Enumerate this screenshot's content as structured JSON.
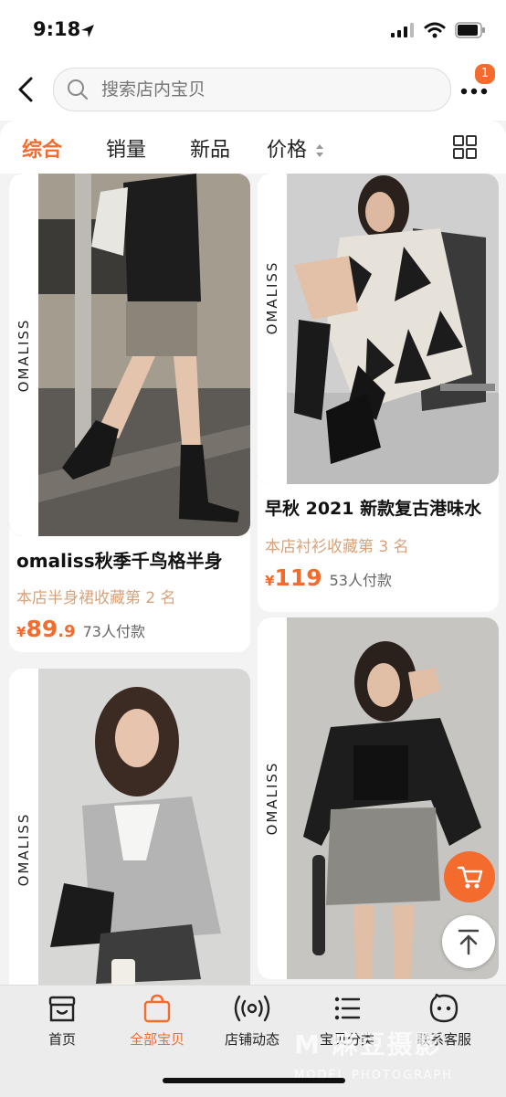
{
  "status": {
    "time": "9:18"
  },
  "search": {
    "placeholder": "搜索店内宝贝",
    "badge_count": "1"
  },
  "sort_tabs": [
    {
      "label": "综合",
      "active": true
    },
    {
      "label": "销量"
    },
    {
      "label": "新品"
    },
    {
      "label": "价格"
    }
  ],
  "products": [
    {
      "brand": "OMALISS",
      "title": "omaliss秋季千鸟格半身",
      "rank": "本店半身裙收藏第 2 名",
      "price_symbol": "¥",
      "price_int": "89",
      "price_dec": ".9",
      "sales": "73人付款"
    },
    {
      "brand": "OMALISS",
      "title": "早秋 2021 新款复古港味水",
      "rank": "本店衬衫收藏第 3 名",
      "price_symbol": "¥",
      "price_int": "119",
      "price_dec": "",
      "sales": "53人付款"
    },
    {
      "brand": "OMALISS"
    },
    {
      "brand": "OMALISS"
    }
  ],
  "bottom_nav": [
    {
      "label": "首页",
      "icon": "storefront-icon"
    },
    {
      "label": "全部宝贝",
      "icon": "shopping-bag-icon",
      "active": true
    },
    {
      "label": "店铺动态",
      "icon": "broadcast-icon"
    },
    {
      "label": "宝贝分类",
      "icon": "list-icon"
    },
    {
      "label": "联系客服",
      "icon": "chat-face-icon"
    }
  ],
  "watermark": {
    "main": "M 麻豆摄影",
    "sub": "MODEL PHOTOGRAPH"
  },
  "colors": {
    "accent": "#f36b2d",
    "rank": "#d9a27a"
  }
}
